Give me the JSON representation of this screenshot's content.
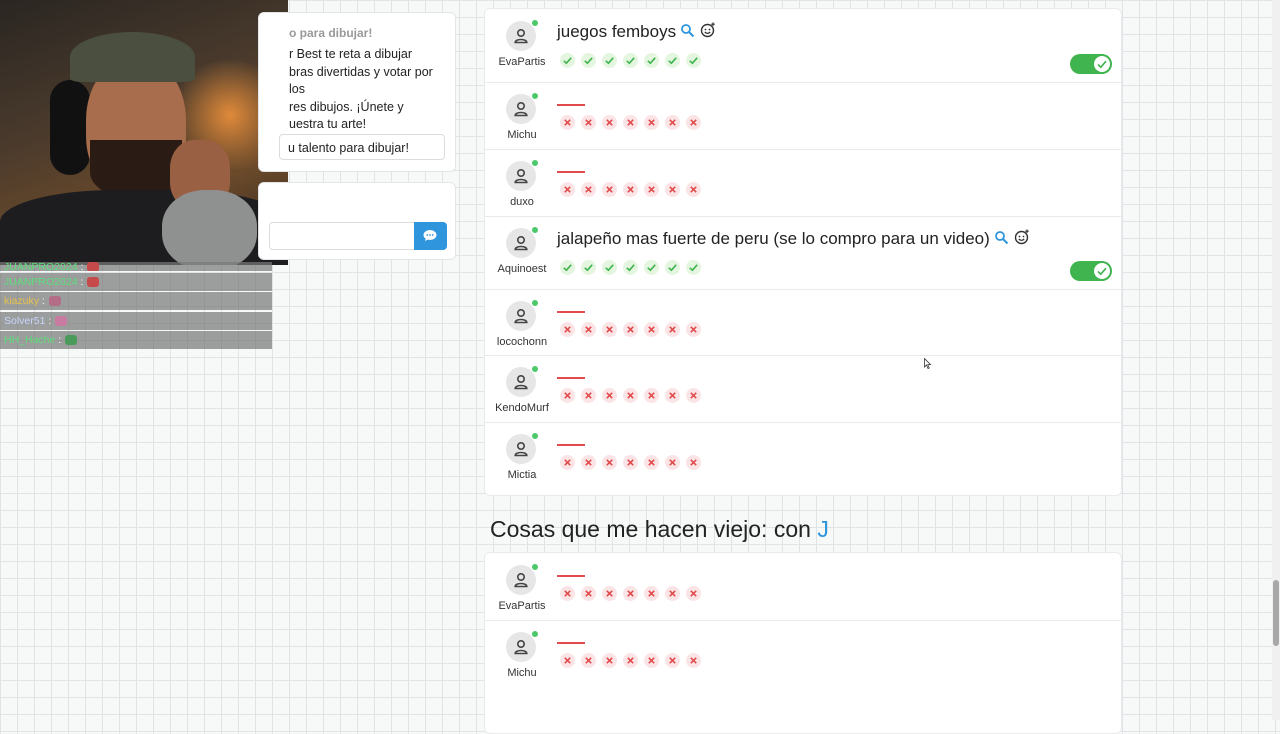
{
  "info_panel": {
    "title": "o para dibujar!",
    "text": "r Best te reta a dibujar\nbras divertidas y votar por los\nres dibujos. ¡Únete y\nuestra tu arte!",
    "cta_label": "u talento para dibujar!"
  },
  "chat_box": {
    "input_placeholder": "",
    "send_icon": "chat-bubble-icon"
  },
  "stream_chat": [
    {
      "user": "JUANPRO2024",
      "sep": " :"
    },
    {
      "user": "JUANPRO2024",
      "sep": " :"
    },
    {
      "user": "kiazuky",
      "sep": " :"
    },
    {
      "user": "Solver51",
      "sep": " :"
    },
    {
      "user": "HH_Hache",
      "sep": " :"
    }
  ],
  "round1": {
    "rows": [
      {
        "user": "EvaPartis",
        "answer": "juegos femboys",
        "accepted": true,
        "votes": [
          "ok",
          "ok",
          "ok",
          "ok",
          "ok",
          "ok",
          "ok"
        ]
      },
      {
        "user": "Michu",
        "answer": "",
        "accepted": false,
        "votes": [
          "no",
          "no",
          "no",
          "no",
          "no",
          "no",
          "no"
        ]
      },
      {
        "user": "duxo",
        "answer": "",
        "accepted": false,
        "votes": [
          "no",
          "no",
          "no",
          "no",
          "no",
          "no",
          "no"
        ]
      },
      {
        "user": "Aquinoest",
        "answer": "jalapeño mas fuerte de peru (se lo compro para un video)",
        "accepted": true,
        "votes": [
          "ok",
          "ok",
          "ok",
          "ok",
          "ok",
          "ok",
          "ok"
        ]
      },
      {
        "user": "locochonn",
        "answer": "",
        "accepted": false,
        "votes": [
          "no",
          "no",
          "no",
          "no",
          "no",
          "no",
          "no"
        ]
      },
      {
        "user": "KendoMurf",
        "answer": "",
        "accepted": false,
        "votes": [
          "no",
          "no",
          "no",
          "no",
          "no",
          "no",
          "no"
        ]
      },
      {
        "user": "Mictia",
        "answer": "",
        "accepted": false,
        "votes": [
          "no",
          "no",
          "no",
          "no",
          "no",
          "no",
          "no"
        ]
      }
    ]
  },
  "round2": {
    "title": "Cosas que me hacen viejo: con",
    "letter": "J",
    "rows": [
      {
        "user": "EvaPartis",
        "answer": "",
        "votes": [
          "no",
          "no",
          "no",
          "no",
          "no",
          "no",
          "no"
        ]
      },
      {
        "user": "Michu",
        "answer": "",
        "votes": [
          "no",
          "no",
          "no",
          "no",
          "no",
          "no",
          "no"
        ]
      }
    ]
  },
  "colors": {
    "accent": "#2f95dc",
    "accepted": "#3fb44f",
    "rejected": "#e24b4b"
  }
}
